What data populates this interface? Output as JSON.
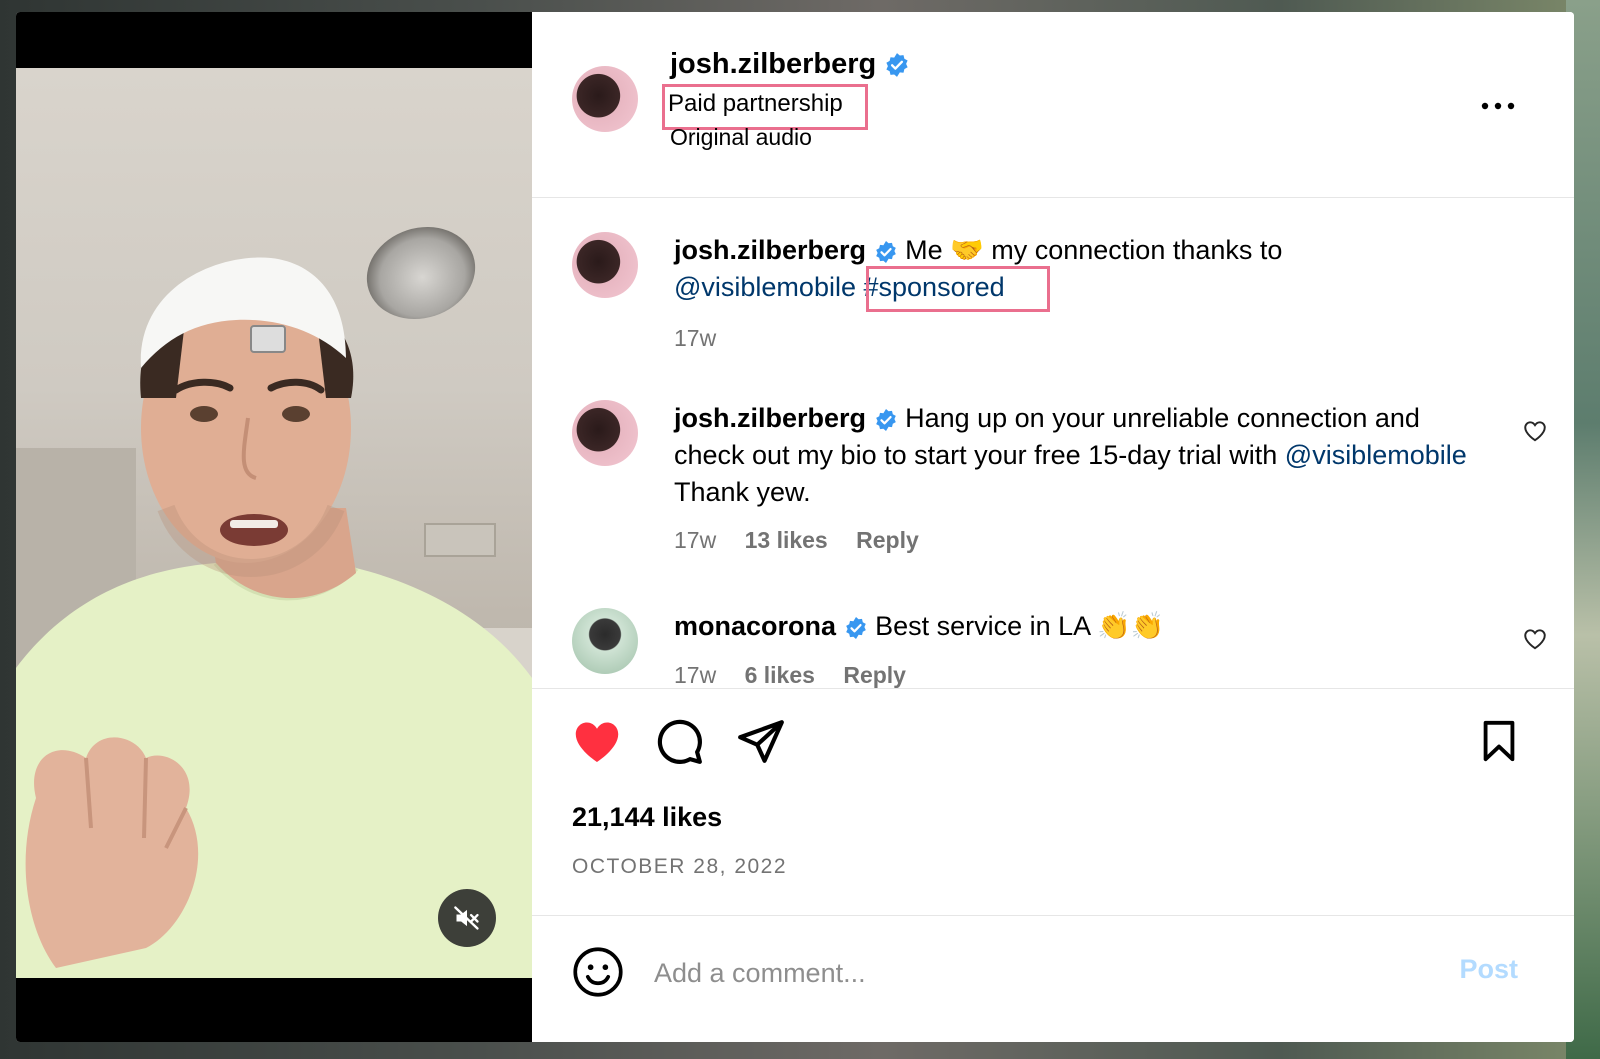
{
  "post": {
    "author": "josh.zilberberg",
    "paid_partnership": "Paid partnership",
    "audio": "Original audio",
    "likes": "21,144 likes",
    "date": "OCTOBER 28, 2022",
    "liked": true,
    "muted": true
  },
  "comments": [
    {
      "username": "josh.zilberberg",
      "verified": true,
      "text_before": "Me",
      "emoji": "🤝",
      "text_after": "my connection thanks to",
      "mention": "@visiblemobile",
      "hashtag": "#sponsored",
      "time": "17w"
    },
    {
      "username": "josh.zilberberg",
      "verified": true,
      "text": "Hang up on your unreliable connection and check out my bio to start your free 15-day trial with",
      "mention": "@visiblemobile",
      "text_end": "Thank yew.",
      "time": "17w",
      "likes": "13 likes",
      "reply": "Reply"
    },
    {
      "username": "monacorona",
      "verified": true,
      "text": "Best service in LA",
      "emoji": "👏👏",
      "time": "17w",
      "likes": "6 likes",
      "reply": "Reply"
    }
  ],
  "composer": {
    "placeholder": "Add a comment...",
    "post_label": "Post"
  },
  "icons": {
    "like": "heart-icon",
    "comment": "comment-icon",
    "share": "share-icon",
    "save": "bookmark-icon",
    "more": "more-icon",
    "emoji": "emoji-icon",
    "mute": "speaker-muted-icon"
  },
  "colors": {
    "like_red": "#ff3040",
    "link_blue": "#00376b",
    "verified_blue": "#3897f0",
    "highlight_pink": "#ea6f8e",
    "post_disabled": "#b3dbff"
  }
}
